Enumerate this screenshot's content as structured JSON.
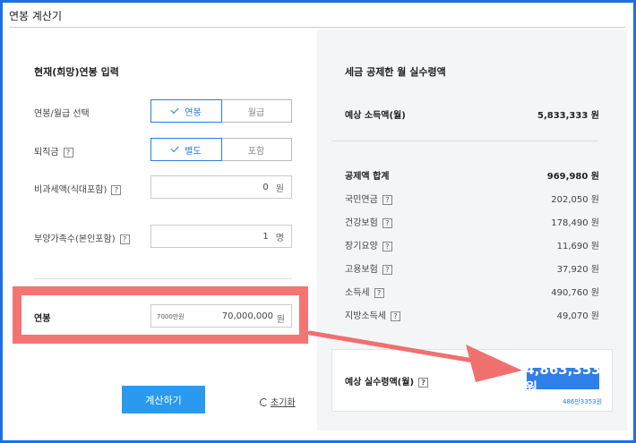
{
  "window": {
    "title": "연봉 계산기"
  },
  "input_section": {
    "title": "현재(희망)연봉 입력",
    "salary_type": {
      "label": "연봉/월급 선택",
      "options": [
        "연봉",
        "월급"
      ],
      "selected": "연봉"
    },
    "severance": {
      "label": "퇴직금",
      "help": "?",
      "options": [
        "별도",
        "포함"
      ],
      "selected": "별도"
    },
    "nontaxable": {
      "label": "비과세액(식대포함)",
      "help": "?",
      "value": "0",
      "unit": "원"
    },
    "dependents": {
      "label": "부양가족수(본인포함)",
      "help": "?",
      "value": "1",
      "unit": "명"
    },
    "salary": {
      "label": "연봉",
      "hint": "7000만원",
      "value": "70,000,000",
      "unit": "원"
    },
    "calculate_label": "계산하기",
    "reset_label": "초기화"
  },
  "result_section": {
    "title": "세금 공제한 월 실수령액",
    "expected_income": {
      "label": "예상 소득액(월)",
      "value": "5,833,333 원"
    },
    "deduction_total": {
      "label": "공제액 합계",
      "value": "969,980 원"
    },
    "deductions": [
      {
        "label": "국민연금",
        "help": "?",
        "value": "202,050 원"
      },
      {
        "label": "건강보험",
        "help": "?",
        "value": "178,490 원"
      },
      {
        "label": "장기요양",
        "help": "?",
        "value": "11,690 원"
      },
      {
        "label": "고용보험",
        "help": "?",
        "value": "37,920 원"
      },
      {
        "label": "소득세",
        "help": "?",
        "value": "490,760 원"
      },
      {
        "label": "지방소득세",
        "help": "?",
        "value": "49,070 원"
      }
    ],
    "net_pay": {
      "label": "예상 실수령액(월)",
      "help": "?",
      "value": "4,863,353원",
      "sub": "486만3353원"
    }
  },
  "colors": {
    "frame": "#1f6fe0",
    "accent": "#2a7de1",
    "button": "#2a9af0",
    "highlight": "#f47474",
    "arrow": "#f07070",
    "result_bg": "#2f7fe8"
  }
}
